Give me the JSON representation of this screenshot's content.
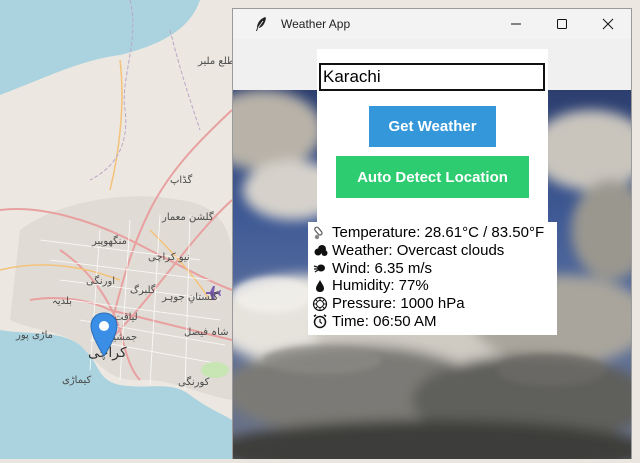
{
  "window": {
    "title": "Weather App",
    "icon": "feather-icon"
  },
  "search": {
    "city_value": "Karachi"
  },
  "buttons": {
    "get_weather": "Get Weather",
    "auto_detect": "Auto Detect Location",
    "get_weather_color": "#3498db",
    "auto_detect_color": "#2ecc71"
  },
  "weather": {
    "temperature": "Temperature: 28.61°C / 83.50°F",
    "conditions": "Weather: Overcast clouds",
    "wind": "Wind: 6.35 m/s",
    "humidity": "Humidity: 77%",
    "pressure": "Pressure: 1000 hPa",
    "time": "Time: 06:50 AM"
  },
  "weather_icons": [
    "thermometer-icon",
    "cloud-icon",
    "wind-icon",
    "droplet-icon",
    "gauge-icon",
    "alarm-clock-icon"
  ],
  "map": {
    "labels": [
      "طلع ملیر",
      "گڈاپ",
      "گلشن معمار",
      "منگھوپیر",
      "نیو کراچی",
      "اورنگی",
      "گلبرگ",
      "بلدیہ",
      "گلستانِ جوہر",
      "لیاقت",
      "جمشید",
      "شاہ فیصل",
      "ماڑی پور",
      "کراچی",
      "کیماڑی",
      "کورنگی"
    ]
  }
}
